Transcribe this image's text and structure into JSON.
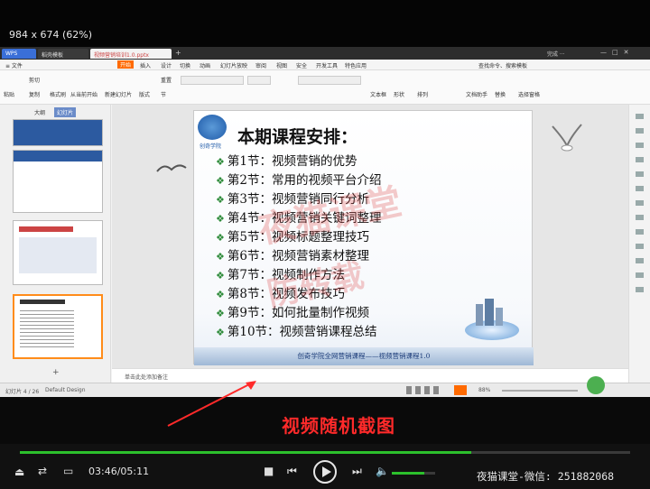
{
  "viewer": {
    "dims": "984 x 674 (62%)"
  },
  "wps": {
    "tabs": [
      {
        "label": "WPS",
        "color": "#3a6fd8"
      },
      {
        "label": "稻壳模板"
      },
      {
        "label": "视频营销培训1.0.pptx"
      }
    ],
    "right_title": "完成 ···",
    "menu": [
      "≡ 文件",
      "开始",
      "插入",
      "设计",
      "切换",
      "动画",
      "幻灯片放映",
      "审阅",
      "视图",
      "安全",
      "开发工具",
      "特色应用"
    ],
    "menu_right": "查找命令、搜索模板",
    "ribbon": [
      "粘贴",
      "剪切",
      "复制",
      "格式刷",
      "从当前开始",
      "新建幻灯片",
      "版式",
      "重置",
      "节",
      "文本框",
      "形状",
      "排列",
      "文档助手",
      "替换",
      "选择窗格"
    ],
    "sidebar": {
      "tab_outline": "大纲",
      "tab_slides": "幻灯片",
      "add": "+"
    },
    "notes_placeholder": "单击此处添加备注",
    "status_left": "幻灯片 4 / 26",
    "status_design": "Default Design",
    "zoom": "88%"
  },
  "slide": {
    "logo_text": "创奇学院",
    "title": "本期课程安排：",
    "items": [
      "第1节：视频营销的优势",
      "第2节：常用的视频平台介绍",
      "第3节：视频营销同行分析",
      "第4节：视频营销关键词整理",
      "第5节：视频标题整理技巧",
      "第6节：视频营销素材整理",
      "第7节：视频制作方法",
      "第8节：视频发布技巧",
      "第9节：如何批量制作视频",
      "第10节：视频营销课程总结"
    ],
    "footer": "创奇学院全网营销课程——视频营销课程1.0",
    "watermark_1": "夜猫课堂",
    "watermark_2": "防转载"
  },
  "caption": "视频随机截图",
  "player": {
    "time": "03:46/05:11",
    "progress": 0.74,
    "volume": 0.75,
    "brand": "夜猫课堂-微信: 251882068"
  },
  "colors": {
    "accent": "#2cc02c",
    "caption": "#ff2a2a",
    "menu_active": "#ff6a00"
  }
}
